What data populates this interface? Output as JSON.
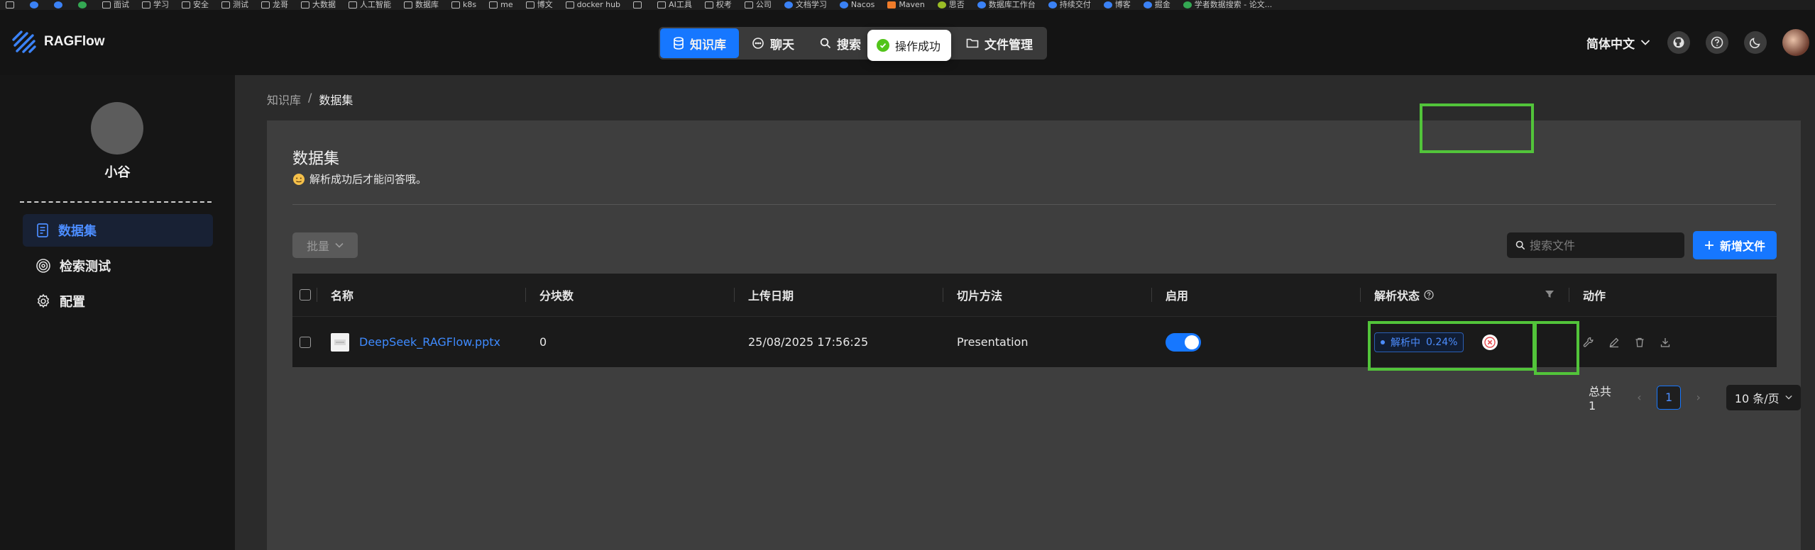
{
  "bookmarks": [
    "",
    "",
    "",
    "",
    "面试",
    "学习",
    "安全",
    "测试",
    "龙哥",
    "大数据",
    "人工智能",
    "数据库",
    "k8s",
    "me",
    "博文",
    "docker hub",
    "",
    "AI工具",
    "权考",
    "公司",
    "文档学习",
    "Nacos",
    "Maven",
    "思否",
    "数据库工作台",
    "持续交付",
    "博客",
    "掘金",
    "学者数据搜索 - 论文..."
  ],
  "header": {
    "app_name": "RAGFlow",
    "nav": [
      {
        "label": "知识库",
        "active": true
      },
      {
        "label": "聊天",
        "active": false
      },
      {
        "label": "搜索",
        "active": false
      },
      {
        "label": "文件管理",
        "active": false
      }
    ],
    "toast": "操作成功",
    "language": "简体中文"
  },
  "sidebar": {
    "user_name": "小谷",
    "items": [
      {
        "label": "数据集",
        "active": true
      },
      {
        "label": "检索测试",
        "active": false
      },
      {
        "label": "配置",
        "active": false
      }
    ]
  },
  "breadcrumb": {
    "root": "知识库",
    "separator": "/",
    "current": "数据集"
  },
  "panel": {
    "title": "数据集",
    "subtitle": "解析成功后才能问答哦。",
    "batch_label": "批量",
    "search_placeholder": "搜索文件",
    "add_label": "新增文件"
  },
  "table": {
    "columns": [
      "名称",
      "分块数",
      "上传日期",
      "切片方法",
      "启用",
      "解析状态",
      "动作"
    ],
    "rows": [
      {
        "name": "DeepSeek_RAGFlow.pptx",
        "chunks": "0",
        "upload_date": "25/08/2025 17:56:25",
        "method": "Presentation",
        "enabled": true,
        "status": "解析中",
        "progress": "0.24%"
      }
    ]
  },
  "pagination": {
    "total": "总共 1",
    "current": "1",
    "page_size": "10 条/页"
  },
  "colors": {
    "primary": "#1677ff",
    "highlight": "#52c43a",
    "success": "#52c41a"
  }
}
